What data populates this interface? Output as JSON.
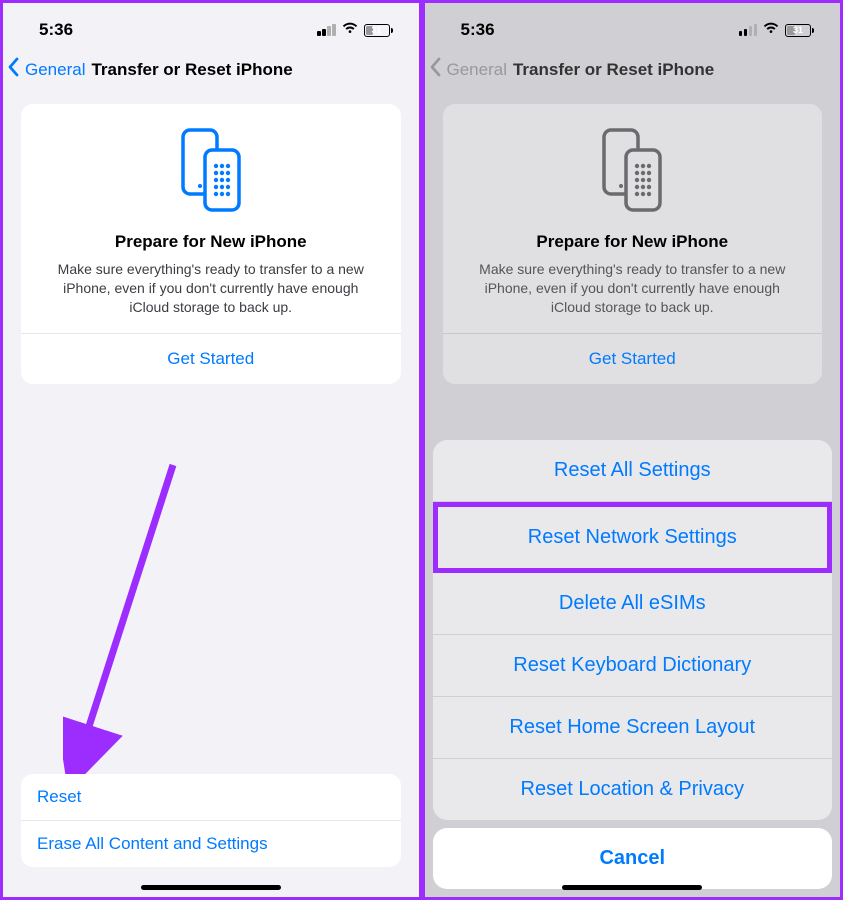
{
  "status": {
    "time": "5:36",
    "battery_level": "31"
  },
  "nav": {
    "back": "General",
    "title": "Transfer or Reset iPhone"
  },
  "prepare": {
    "title": "Prepare for New iPhone",
    "description": "Make sure everything's ready to transfer to a new iPhone, even if you don't currently have enough iCloud storage to back up.",
    "cta": "Get Started"
  },
  "bottom": {
    "reset": "Reset",
    "erase": "Erase All Content and Settings"
  },
  "sheet": {
    "reset_all": "Reset All Settings",
    "reset_network": "Reset Network Settings",
    "delete_esim": "Delete All eSIMs",
    "reset_keyboard": "Reset Keyboard Dictionary",
    "reset_home": "Reset Home Screen Layout",
    "reset_location": "Reset Location & Privacy",
    "cancel": "Cancel"
  }
}
